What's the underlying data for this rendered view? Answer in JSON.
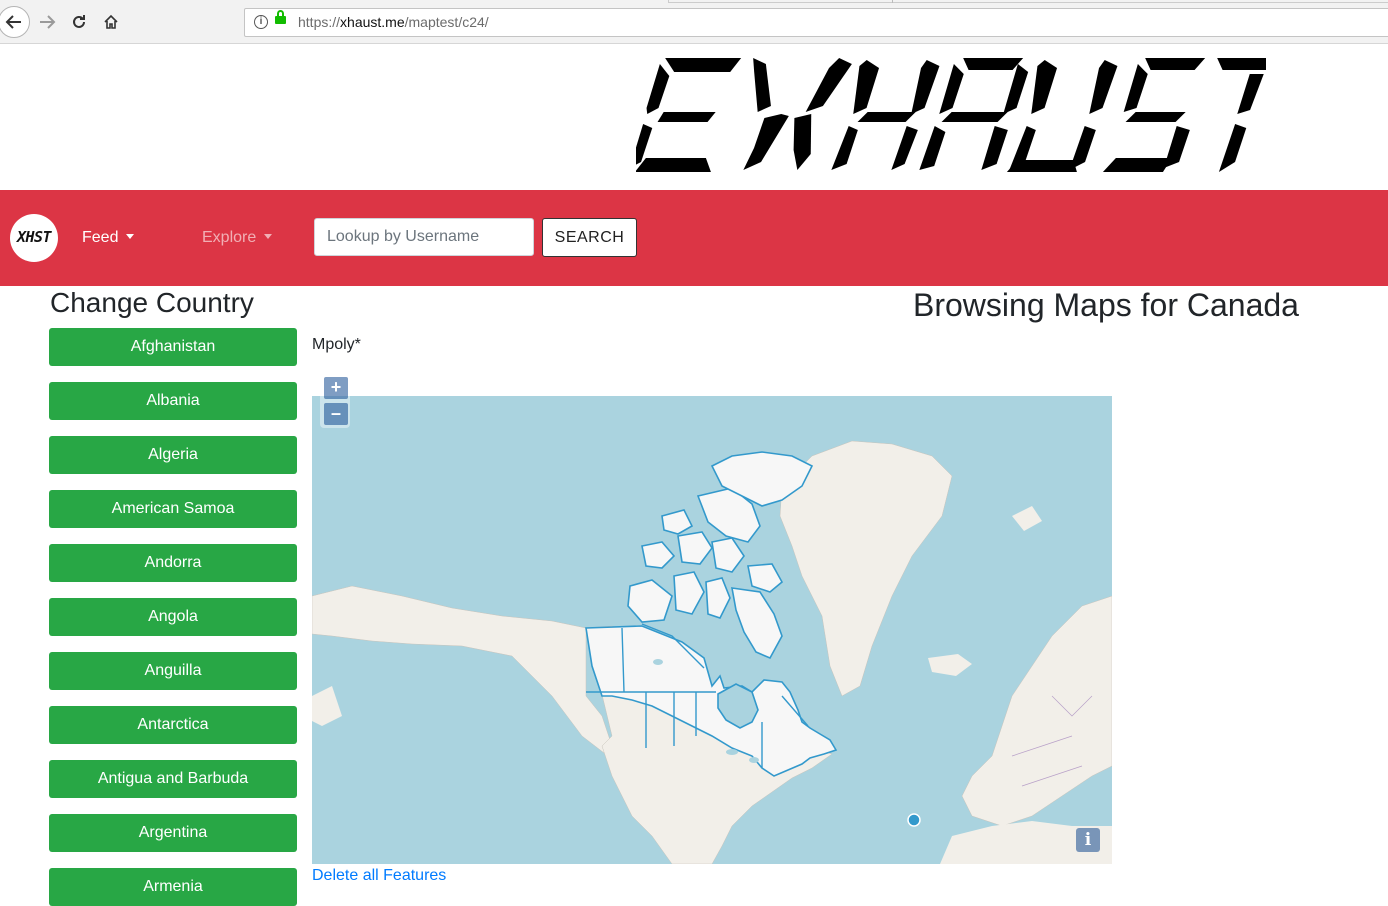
{
  "browser": {
    "url_scheme": "https://",
    "url_host": "xhaust.me",
    "url_path": "/maptest/c24/"
  },
  "banner": {
    "logo_text": "EXHAUST"
  },
  "navbar": {
    "brand_text": "XHST",
    "feed_label": "Feed",
    "explore_label": "Explore",
    "search_placeholder": "Lookup by Username",
    "search_button": "SEARCH",
    "bg_color": "#dc3545"
  },
  "sidebar": {
    "title": "Change Country",
    "countries": [
      "Afghanistan",
      "Albania",
      "Algeria",
      "American Samoa",
      "Andorra",
      "Angola",
      "Anguilla",
      "Antarctica",
      "Antigua and Barbuda",
      "Argentina",
      "Armenia"
    ],
    "button_color": "#28a745"
  },
  "main": {
    "title": "Browsing Maps for Canada",
    "draw_mode_label": "Mpoly*",
    "map": {
      "zoom_in": "+",
      "zoom_out": "–",
      "attribution_button": "i"
    },
    "delete_link": "Delete all Features"
  }
}
